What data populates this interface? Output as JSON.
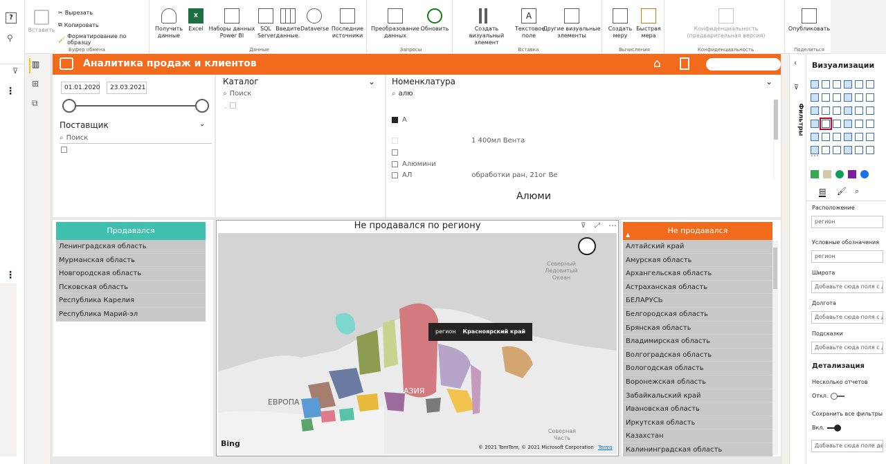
{
  "ribbon": {
    "clipboard": {
      "paste": "Вставить",
      "cut": "Вырезать",
      "copy": "Копировать",
      "format_painter": "Форматирование по образцу",
      "group": "Буфер обмена"
    },
    "data": {
      "get_data": "Получить данные",
      "excel": "Excel",
      "datasets": "Наборы данных Power BI",
      "sql": "SQL Server",
      "enter_data": "Введите данные.",
      "dataverse": "Dataverse",
      "recent": "Последние источники",
      "group": "Данные"
    },
    "queries": {
      "transform": "Преобразование данных",
      "refresh": "Обновить",
      "group": "Запросы"
    },
    "insert": {
      "new_visual": "Создать визуальный элемент",
      "text_box": "Текстовое поле",
      "more_visuals": "Другие визуальные элементы",
      "group": "Вставка"
    },
    "calc": {
      "new_measure": "Создать меру",
      "quick_measure": "Быстрая мера",
      "group": "Вычисления"
    },
    "sensitivity": {
      "label": "Конфиденциальность (предварительная версия)",
      "group": "Конфиденциальность"
    },
    "share": {
      "publish": "Опубликовать",
      "group": "Поделиться"
    }
  },
  "report": {
    "title": "Аналитика продаж и клиентов",
    "date_from": "01.01.2020",
    "date_to": "23.03.2021",
    "supplier": {
      "title": "Поставщик",
      "search": "Поиск"
    },
    "catalog": {
      "title": "Каталог",
      "search": "Поиск"
    },
    "nomenclature": {
      "title": "Номенклатура",
      "search": "алю",
      "items": [
        "А",
        "",
        "1 400мл Вента",
        "",
        "Алюмини",
        "АЛ",
        "обработки ран, 21ог Ве"
      ],
      "card_value": "Алюми"
    },
    "sold": {
      "title": "Продавался",
      "rows": [
        "Ленинградская область",
        "Мурманская область",
        "Новгородская область",
        "Псковская область",
        "Республика Карелия",
        "Республика Марий-эл"
      ]
    },
    "map": {
      "title": "Не продавался по региону",
      "tooltip_key": "регион",
      "tooltip_value": "Красноярский край",
      "label_arctic": "Северный Ледовитый Океан",
      "label_europe": "ЕВРОПА",
      "label_asia": "АЗИЯ",
      "label_north": "Северная Часть",
      "bing": "Bing",
      "copyright": "© 2021 TomTom, © 2021 Microsoft Corporation",
      "terms": "Terms"
    },
    "not_sold": {
      "title": "Не продавался",
      "rows": [
        "Алтайский край",
        "Амурская область",
        "Архангельская область",
        "Астраханская область",
        "БЕЛАРУСЬ",
        "Белгородская область",
        "Брянская область",
        "Владимирская область",
        "Волгоградская область",
        "Вологодская область",
        "Воронежская область",
        "Забайкальский край",
        "Ивановская область",
        "Иркутская область",
        "Казахстан",
        "Калининградская область"
      ]
    }
  },
  "panes": {
    "filters": "Фильтры",
    "viz_title": "Визуализации",
    "location": "Расположение",
    "location_value": "регион",
    "legend": "Условные обозначения",
    "legend_value": "регион",
    "latitude": "Широта",
    "latitude_ph": "Добавьте сюда поля с данными",
    "longitude": "Долгота",
    "longitude_ph": "Добавьте сюда поля с данными",
    "tooltips": "Подсказки",
    "tooltips_ph": "Добавьте сюда поля с данными",
    "drill": "Детализация",
    "multi_reports": "Несколько отчетов",
    "off": "Откл.",
    "keep_filters": "Сохранить все фильтры",
    "on": "Вкл.",
    "drill_ph": "Добавьте сюда поле детализации"
  },
  "colors": {
    "accent": "#f26b1d",
    "teal": "#3fbfad",
    "highlight": "#d0021b"
  }
}
